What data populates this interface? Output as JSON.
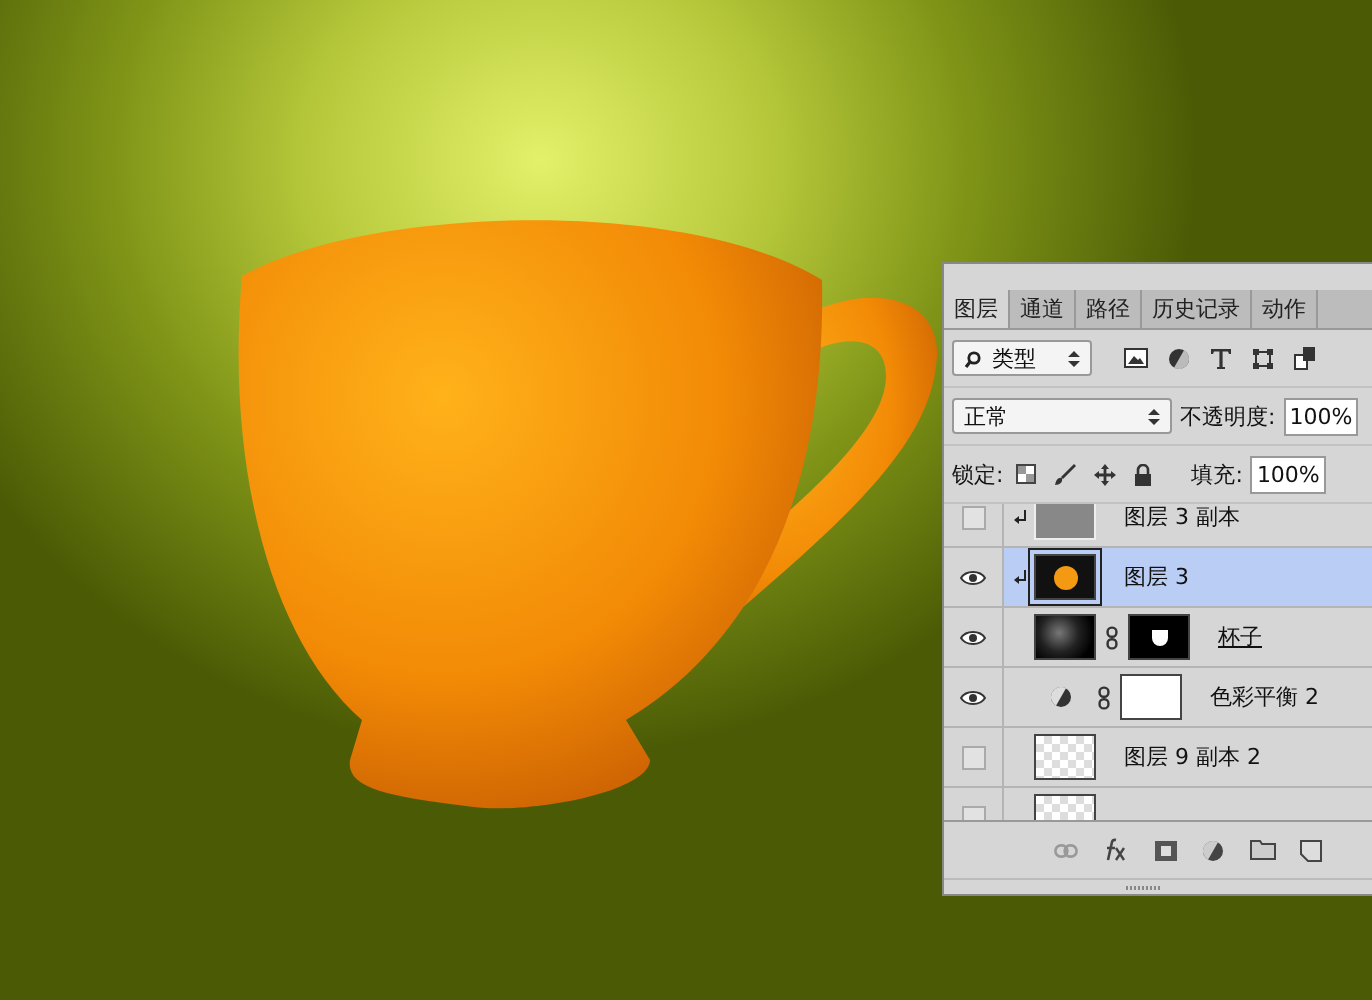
{
  "panel": {
    "tabs": [
      {
        "label": "图层",
        "selected": true
      },
      {
        "label": "通道",
        "selected": false
      },
      {
        "label": "路径",
        "selected": false
      },
      {
        "label": "历史记录",
        "selected": false
      },
      {
        "label": "动作",
        "selected": false
      }
    ],
    "filter": {
      "value": "类型"
    },
    "blend_mode": {
      "value": "正常"
    },
    "opacity": {
      "label": "不透明度:",
      "value": "100%"
    },
    "lock": {
      "label": "锁定:"
    },
    "fill": {
      "label": "填充:",
      "value": "100%"
    },
    "layers": [
      {
        "name": "图层 3 副本",
        "visible": false,
        "clipped": true,
        "selected": false,
        "underlined": false,
        "kind": "gray",
        "mask": false
      },
      {
        "name": "图层 3",
        "visible": true,
        "clipped": true,
        "selected": true,
        "underlined": false,
        "kind": "orange",
        "mask": false
      },
      {
        "name": "杯子",
        "visible": true,
        "clipped": false,
        "selected": false,
        "underlined": true,
        "kind": "photo",
        "mask": true
      },
      {
        "name": "色彩平衡 2",
        "visible": true,
        "clipped": false,
        "selected": false,
        "underlined": false,
        "kind": "adjustment",
        "mask": true
      },
      {
        "name": "图层 9 副本 2",
        "visible": false,
        "clipped": false,
        "selected": false,
        "underlined": false,
        "kind": "transparent",
        "mask": false
      }
    ]
  }
}
